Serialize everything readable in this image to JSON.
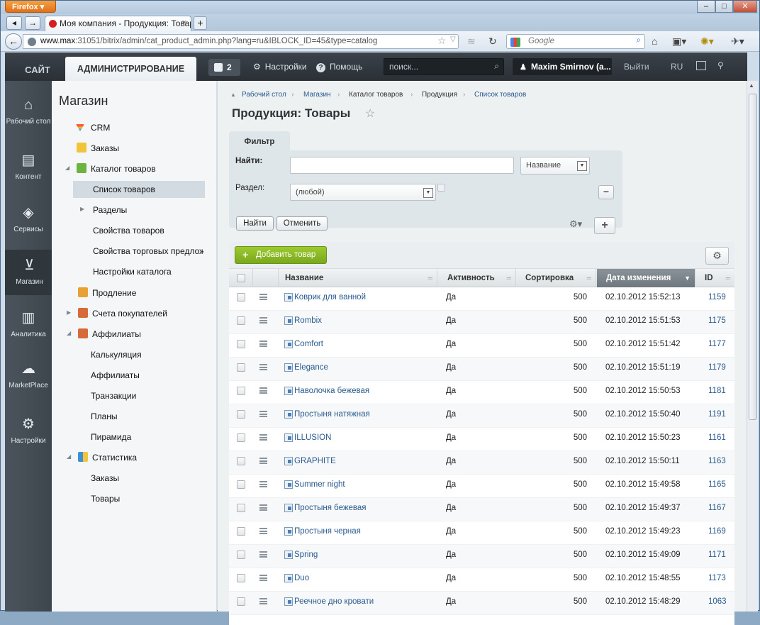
{
  "browser": {
    "app_button": "Firefox",
    "tab_title": "Моя компания - Продукция: Товары",
    "tab_close": "×",
    "new_tab": "+",
    "url_host": "www.max",
    "url_rest": ":31051/bitrix/admin/cat_product_admin.php?lang=ru&IBLOCK_ID=45&type=catalog",
    "search_placeholder": "Google",
    "win_min": "–",
    "win_max": "□",
    "win_close": "✕"
  },
  "panel": {
    "site_tab": "САЙТ",
    "admin_tab": "АДМИНИСТРИРОВАНИЕ",
    "notifications_count": "2",
    "settings": "Настройки",
    "help": "Помощь",
    "search_placeholder": "поиск...",
    "user": "Maxim Smirnov (a...",
    "logout": "Выйти",
    "lang": "RU"
  },
  "leftmenu": [
    {
      "label": "Рабочий стол",
      "icon": "home-icon"
    },
    {
      "label": "Контент",
      "icon": "document-icon"
    },
    {
      "label": "Сервисы",
      "icon": "layers-icon"
    },
    {
      "label": "Магазин",
      "icon": "basket-icon"
    },
    {
      "label": "Аналитика",
      "icon": "bar-chart-icon"
    },
    {
      "label": "MarketPlace",
      "icon": "cloud-icon"
    },
    {
      "label": "Настройки",
      "icon": "gear-icon"
    }
  ],
  "submenu": {
    "title": "Магазин",
    "items": [
      {
        "label": "CRM"
      },
      {
        "label": "Заказы"
      },
      {
        "label": "Каталог товаров"
      },
      {
        "label": "Список товаров"
      },
      {
        "label": "Разделы"
      },
      {
        "label": "Свойства товаров"
      },
      {
        "label": "Свойства торговых предложений"
      },
      {
        "label": "Настройки каталога"
      },
      {
        "label": "Продление"
      },
      {
        "label": "Счета покупателей"
      },
      {
        "label": "Аффилиаты"
      },
      {
        "label": "Калькуляция"
      },
      {
        "label": "Аффилиаты"
      },
      {
        "label": "Транзакции"
      },
      {
        "label": "Планы"
      },
      {
        "label": "Пирамида"
      },
      {
        "label": "Статистика"
      },
      {
        "label": "Заказы"
      },
      {
        "label": "Товары"
      }
    ]
  },
  "breadcrumb": [
    "Рабочий стол",
    "Магазин",
    "Каталог товаров",
    "Продукция",
    "Список товаров"
  ],
  "page_title": "Продукция: Товары",
  "filter": {
    "tab": "Фильтр",
    "find_label": "Найти:",
    "find_value": "",
    "find_field": "Название",
    "section_label": "Раздел:",
    "section_value": "(любой)",
    "find_button": "Найти",
    "cancel_button": "Отменить"
  },
  "grid": {
    "add_button": "Добавить товар",
    "columns": [
      "Название",
      "Активность",
      "Сортировка",
      "Дата изменения",
      "ID"
    ],
    "rows": [
      {
        "name": "Коврик для ванной",
        "active": "Да",
        "sort": "500",
        "date": "02.10.2012 15:52:13",
        "id": "1159"
      },
      {
        "name": "Rombix",
        "active": "Да",
        "sort": "500",
        "date": "02.10.2012 15:51:53",
        "id": "1175"
      },
      {
        "name": "Comfort",
        "active": "Да",
        "sort": "500",
        "date": "02.10.2012 15:51:42",
        "id": "1177"
      },
      {
        "name": "Elegance",
        "active": "Да",
        "sort": "500",
        "date": "02.10.2012 15:51:19",
        "id": "1179"
      },
      {
        "name": "Наволочка бежевая",
        "active": "Да",
        "sort": "500",
        "date": "02.10.2012 15:50:53",
        "id": "1181"
      },
      {
        "name": "Простыня натяжная",
        "active": "Да",
        "sort": "500",
        "date": "02.10.2012 15:50:40",
        "id": "1191"
      },
      {
        "name": "ILLUSION",
        "active": "Да",
        "sort": "500",
        "date": "02.10.2012 15:50:23",
        "id": "1161"
      },
      {
        "name": "GRAPHITE",
        "active": "Да",
        "sort": "500",
        "date": "02.10.2012 15:50:11",
        "id": "1163"
      },
      {
        "name": "Summer night",
        "active": "Да",
        "sort": "500",
        "date": "02.10.2012 15:49:58",
        "id": "1165"
      },
      {
        "name": "Простыня бежевая",
        "active": "Да",
        "sort": "500",
        "date": "02.10.2012 15:49:37",
        "id": "1167"
      },
      {
        "name": "Простыня черная",
        "active": "Да",
        "sort": "500",
        "date": "02.10.2012 15:49:23",
        "id": "1169"
      },
      {
        "name": "Spring",
        "active": "Да",
        "sort": "500",
        "date": "02.10.2012 15:49:09",
        "id": "1171"
      },
      {
        "name": "Duo",
        "active": "Да",
        "sort": "500",
        "date": "02.10.2012 15:48:55",
        "id": "1173"
      },
      {
        "name": "Реечное дно кровати",
        "active": "Да",
        "sort": "500",
        "date": "02.10.2012 15:48:29",
        "id": "1063"
      }
    ]
  }
}
